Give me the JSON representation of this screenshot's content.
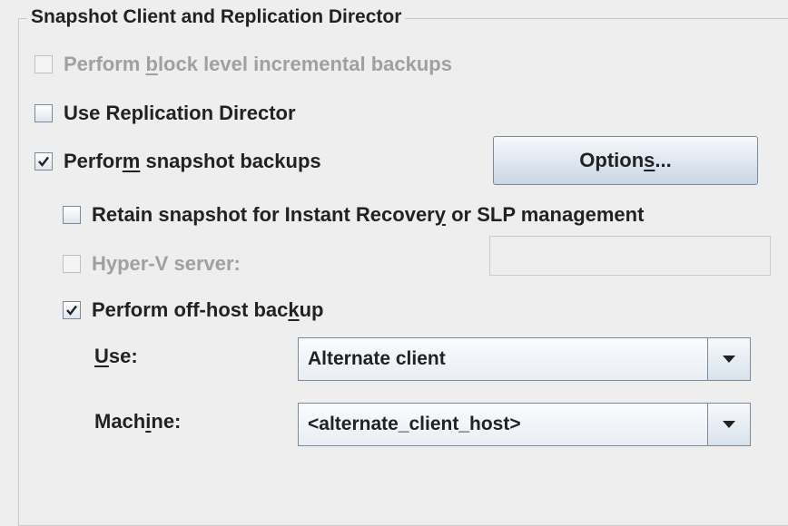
{
  "group": {
    "title": "Snapshot Client and Replication Director"
  },
  "options": {
    "block_level": {
      "pre": "Perform ",
      "mnemonic": "b",
      "post": "lock level incremental backups",
      "checked": false,
      "enabled": false
    },
    "replication_director": {
      "pre": "Use Replication Director",
      "mnemonic": "",
      "post": "",
      "checked": false,
      "enabled": true
    },
    "snapshot_backups": {
      "pre": "Perfor",
      "mnemonic": "m",
      "post": " snapshot backups",
      "checked": true,
      "enabled": true
    },
    "retain_snapshot": {
      "pre": "Retain snapshot for Instant Recover",
      "mnemonic": "y",
      "post": " or SLP management",
      "checked": false,
      "enabled": true
    },
    "hyperv": {
      "pre": "Hyper-V server:",
      "mnemonic": "",
      "post": "",
      "checked": false,
      "enabled": false,
      "field_value": ""
    },
    "offhost": {
      "pre": "Perform off-host bac",
      "mnemonic": "k",
      "post": "up",
      "checked": true,
      "enabled": true
    }
  },
  "options_button": {
    "pre": "Option",
    "mnemonic": "s",
    "post": "..."
  },
  "use_field": {
    "label_pre": "",
    "label_mnemonic": "U",
    "label_post": "se:",
    "value": "Alternate client"
  },
  "machine_field": {
    "label_pre": "Mach",
    "label_mnemonic": "i",
    "label_post": "ne:",
    "value": "<alternate_client_host>"
  },
  "icons": {
    "checkmark": "checkmark-icon",
    "dropdown": "chevron-down-icon"
  }
}
